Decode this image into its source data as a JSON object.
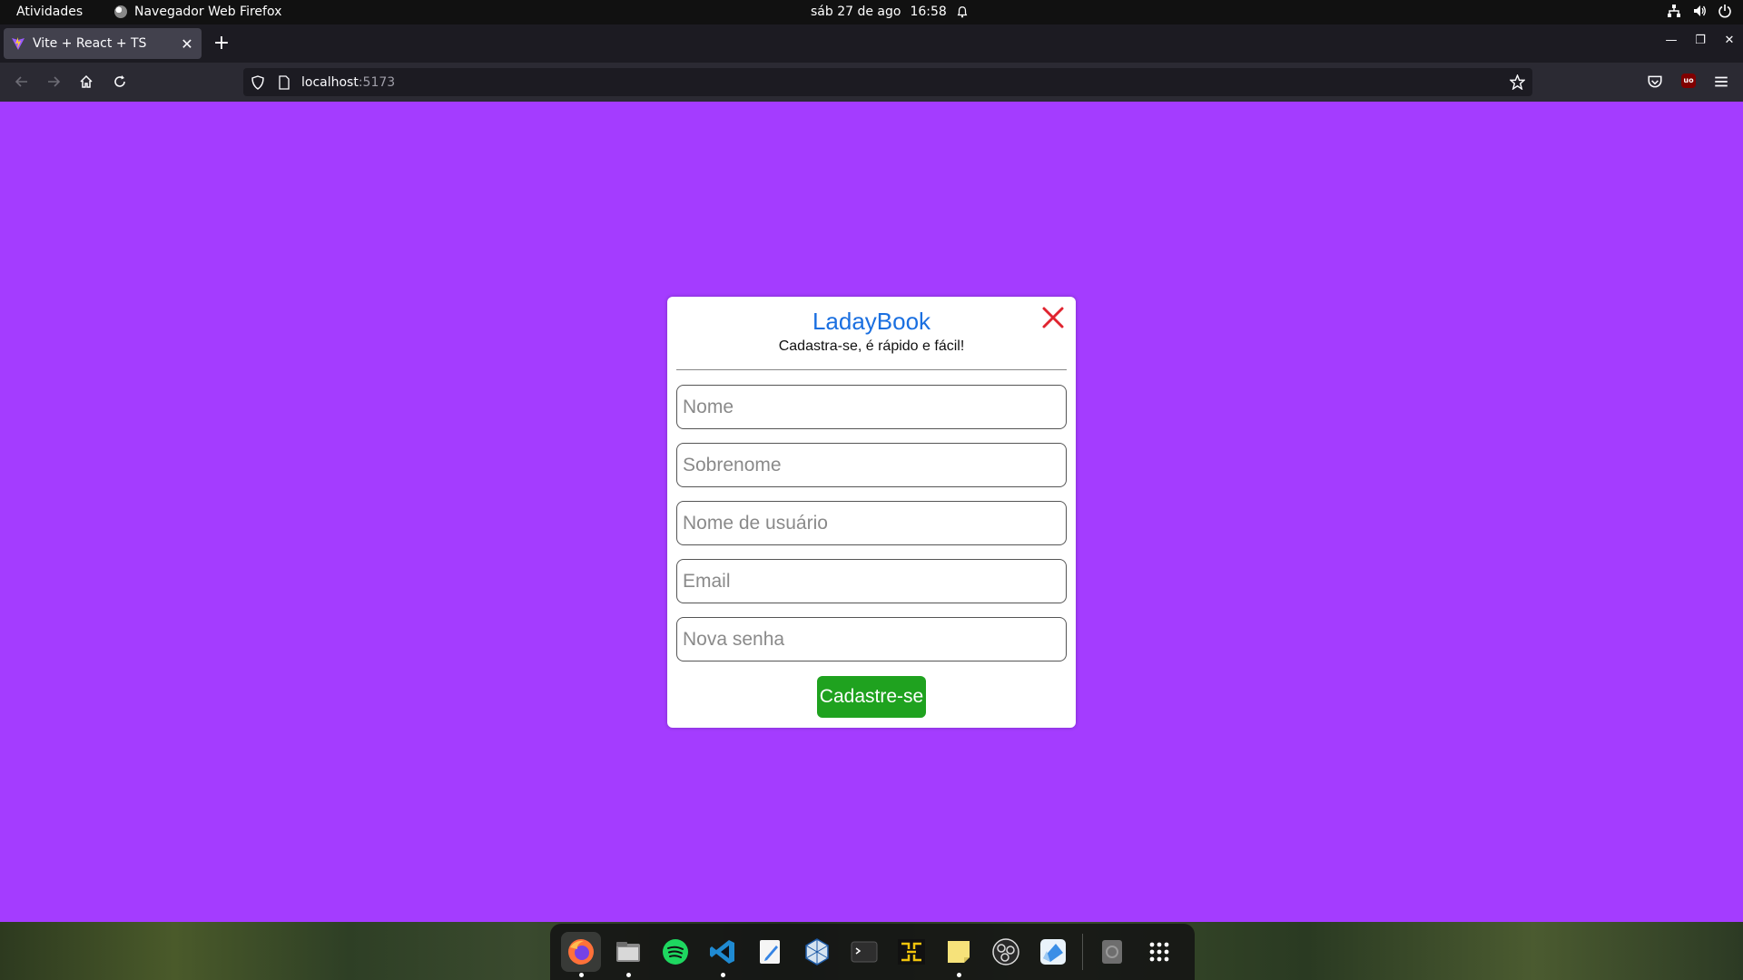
{
  "system": {
    "activities": "Atividades",
    "app_name": "Navegador Web Firefox",
    "date": "sáb 27 de ago",
    "time": "16:58"
  },
  "browser": {
    "tab_title": "Vite + React + TS",
    "url_host": "localhost",
    "url_port": ":5173"
  },
  "modal": {
    "brand": "LadayBook",
    "subtitle": "Cadastra-se, é rápido e fácil!",
    "fields": {
      "first_name": "Nome",
      "last_name": "Sobrenome",
      "username": "Nome de usuário",
      "email": "Email",
      "password": "Nova senha"
    },
    "submit_label": "Cadastre-se"
  },
  "colors": {
    "page_background": "#a43cff",
    "brand": "#1a6fe0",
    "close": "#e0242f",
    "submit": "#1fa21f"
  },
  "dock": {
    "icons": [
      "firefox-icon",
      "files-icon",
      "spotify-icon",
      "vscode-icon",
      "text-editor-icon",
      "virtualbox-icon",
      "terminal-icon",
      "network-tool-icon",
      "sticky-notes-icon",
      "obs-icon",
      "transfer-app-icon",
      "disk-icon",
      "show-apps-icon"
    ]
  }
}
